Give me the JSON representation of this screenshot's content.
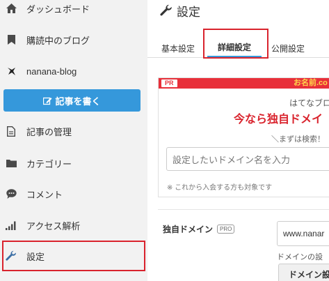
{
  "sidebar": {
    "items": [
      {
        "label": "ダッシュボード",
        "icon": "home-icon"
      },
      {
        "label": "購読中のブログ",
        "icon": "bookmark-icon"
      },
      {
        "label": "nanana-blog",
        "icon": "blog-logo-icon"
      },
      {
        "label": "記事の管理",
        "icon": "document-icon"
      },
      {
        "label": "カテゴリー",
        "icon": "folder-icon"
      },
      {
        "label": "コメント",
        "icon": "comment-icon"
      },
      {
        "label": "アクセス解析",
        "icon": "bar-chart-icon"
      },
      {
        "label": "設定",
        "icon": "wrench-icon"
      }
    ],
    "write_button": "記事を書く"
  },
  "main": {
    "title": "設定",
    "tabs": [
      {
        "label": "基本設定"
      },
      {
        "label": "詳細設定",
        "active": true
      },
      {
        "label": "公開設定"
      }
    ],
    "promo": {
      "badge": "PR",
      "brand": "お名前.co",
      "line1": "はてなブロ",
      "line2": "今なら独自ドメイ",
      "line3": "＼まずは検索！ ド",
      "search_placeholder": "設定したいドメイン名を入力",
      "note": "※ これから入会する方も対象です"
    },
    "domain": {
      "label": "独自ドメイン",
      "pro_badge": "PRO",
      "value": "www.nanar",
      "help": "ドメインの設",
      "button": "ドメイン設"
    }
  },
  "colors": {
    "accent": "#3598db",
    "highlight": "#d9232d",
    "promo_red": "#e8303a"
  }
}
